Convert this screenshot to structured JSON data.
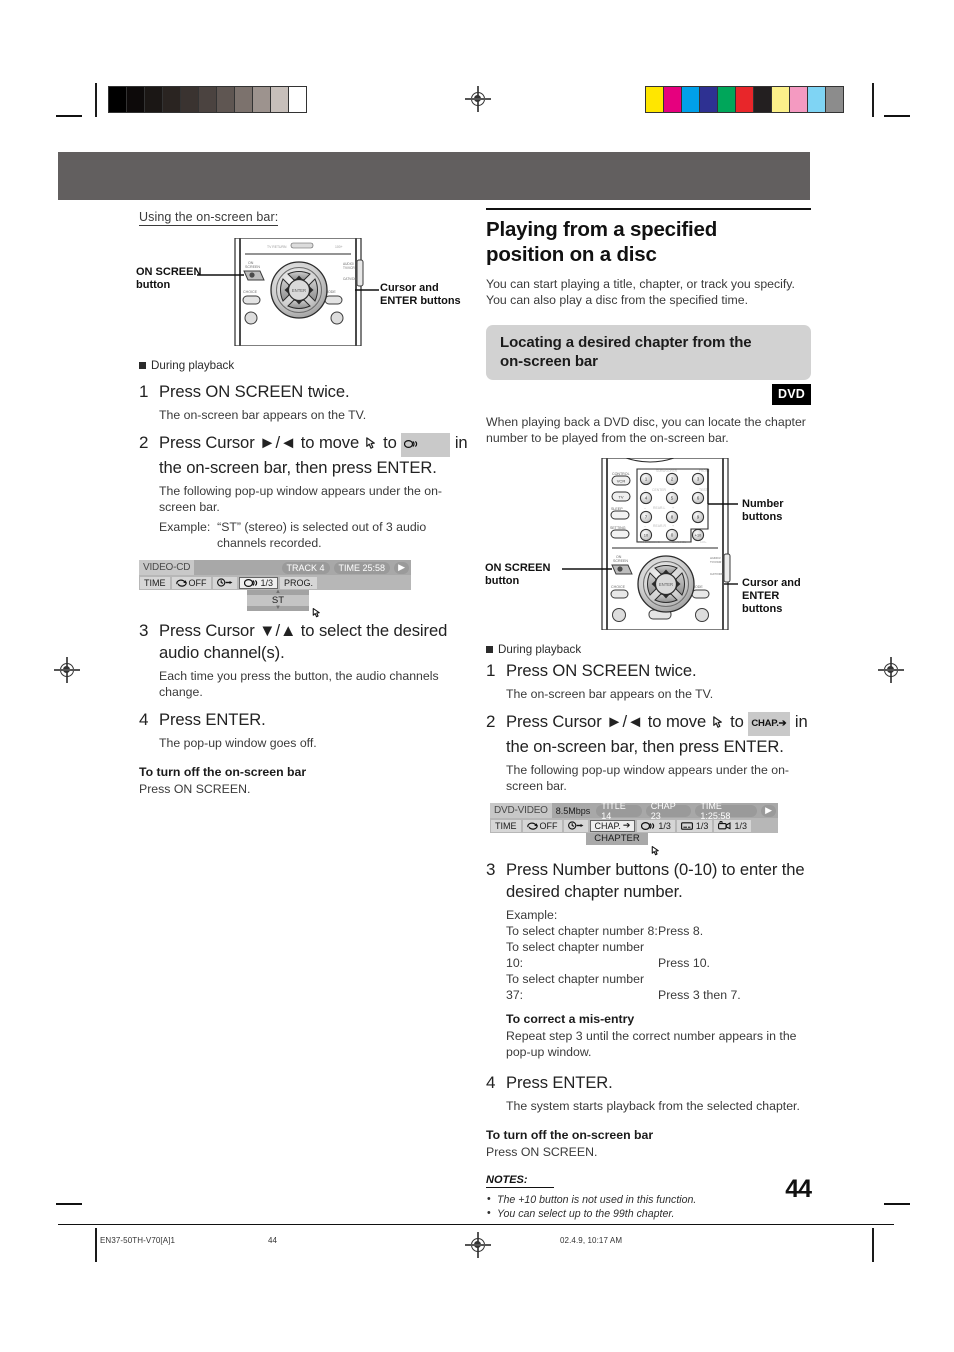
{
  "colors": {
    "masthead": "#625f5f",
    "gray_heading_box": "#d2d2d2",
    "badge_bg": "#000000",
    "osd_bar": "#b7b7b7"
  },
  "calibration": {
    "gray_wedge": [
      "#000000",
      "#0d0a0a",
      "#1b1715",
      "#2a2421",
      "#3a3330",
      "#4b4340",
      "#5f5652",
      "#7c726d",
      "#9d938e",
      "#c7bfba",
      "#ffffff"
    ],
    "color_bars": [
      "#ffe600",
      "#e6007e",
      "#00a0e9",
      "#2e3192",
      "#00a65a",
      "#e8262a",
      "#231f20",
      "#fbf08a",
      "#f49ac1",
      "#7fd4f4",
      "#8c8c8c"
    ]
  },
  "left_column": {
    "subhead": "Using the on-screen bar:",
    "remote": {
      "callout_on_screen": "ON SCREEN\nbutton",
      "callout_on_screen_line1": "ON SCREEN",
      "callout_on_screen_line2": "button",
      "callout_cursor_line1": "Cursor and",
      "callout_cursor_line2": "ENTER buttons",
      "button_labels": [
        "ON SCREEN",
        "CHOICE",
        "ENTER",
        "MODE",
        "AUDIO TV/VCR",
        "CATV/DBS"
      ]
    },
    "section_marker": "During playback",
    "steps": [
      {
        "num": "1",
        "title": "Press ON SCREEN twice.",
        "desc": "The on-screen bar appears on the TV."
      },
      {
        "num": "2",
        "title_pre": "Press Cursor ►/◄ to move ",
        "title_mid": " to ",
        "chip": "⟨⟨⟩",
        "title_post": " in the on-screen bar, then press ENTER.",
        "desc": "The following pop-up window appears under the on-screen bar.",
        "example_label": "Example:",
        "example_text": "“ST” (stereo) is selected out of 3 audio channels recorded."
      },
      {
        "num": "3",
        "title": "Press Cursor ▼/▲ to select the desired audio channel(s).",
        "desc": "Each time you press the button, the audio channels change."
      },
      {
        "num": "4",
        "title": "Press ENTER.",
        "desc": "The pop-up window goes off."
      }
    ],
    "turn_off_heading": "To turn off the on-screen bar",
    "turn_off_text": "Press ON SCREEN."
  },
  "left_osd": {
    "disc_label": "VIDEO-CD",
    "row1_pills": [
      "TRACK 4",
      "TIME    25:58"
    ],
    "row1_play_icon": "▶",
    "row2": [
      {
        "text": "TIME",
        "type": "box"
      },
      {
        "text": "OFF",
        "type": "box",
        "icon": "repeat"
      },
      {
        "text": "",
        "type": "box",
        "icon": "clock-arrow"
      },
      {
        "text": "1/3",
        "type": "box",
        "icon": "audio",
        "selected": true
      },
      {
        "text": "PROG.",
        "type": "box"
      }
    ],
    "popup_value": "ST"
  },
  "right_column": {
    "title_line1": "Playing from a specified",
    "title_line2": "position on a disc",
    "lede_line1": "You can start playing a title, chapter, or track you specify.",
    "lede_line2": "You can also play a disc from the specified time.",
    "gray_heading_line1": "Locating a desired chapter from the",
    "gray_heading_line2": "on-screen bar",
    "badge": "DVD",
    "intro_line1": "When playing back a DVD disc, you can locate the chapter",
    "intro_line2": "number to be played from the on-screen bar.",
    "remote": {
      "callout_number_buttons": "Number buttons",
      "callout_on_screen_line1": "ON SCREEN",
      "callout_on_screen_line2": "button",
      "callout_cursor_line1": "Cursor and",
      "callout_cursor_line2": "ENTER buttons",
      "control_label": "CONTROL",
      "side_buttons": [
        "VCR",
        "TV",
        "SLEEP",
        "SETTING",
        "CHOICE",
        "MODE"
      ],
      "faint_labels": [
        "CENTER",
        "REAR-L",
        "REAR-R",
        "TEST"
      ],
      "keypad": [
        "1",
        "2",
        "3",
        "4",
        "5",
        "6",
        "7",
        "8",
        "9",
        "10",
        "0",
        "+10"
      ],
      "enter_label": "ENTER",
      "right_labels": [
        "AUDIO TV/VCR",
        "CATV/DBS"
      ]
    },
    "section_marker": "During playback",
    "steps": [
      {
        "num": "1",
        "title": "Press ON SCREEN twice.",
        "desc": "The on-screen bar appears on the TV."
      },
      {
        "num": "2",
        "title_pre": "Press Cursor ►/◄ to move ",
        "title_mid": " to ",
        "chip": "CHAP.",
        "title_post": " in the on-screen bar, then press ENTER.",
        "desc": "The following pop-up window appears under the on-screen bar."
      },
      {
        "num": "3",
        "title": "Press Number buttons (0-10) to enter the desired chapter number.",
        "example_label": "Example:",
        "examples": [
          {
            "left": "To select chapter number 8:",
            "right": "Press 8."
          },
          {
            "left": "To select chapter number 10:",
            "right": "Press 10."
          },
          {
            "left": "To select chapter number 37:",
            "right": "Press 3 then 7."
          }
        ],
        "correct_heading": "To correct a mis-entry",
        "correct_text": "Repeat step 3 until the correct number appears in the pop-up window."
      },
      {
        "num": "4",
        "title": "Press ENTER.",
        "desc": "The system starts playback from the selected chapter."
      }
    ],
    "turn_off_heading": "To turn off the on-screen bar",
    "turn_off_text": "Press ON SCREEN.",
    "notes_heading": "NOTES:",
    "notes": [
      "The +10 button is not used in this function.",
      "You can select up to the 99th chapter."
    ]
  },
  "right_osd": {
    "disc_label": "DVD-VIDEO",
    "bitrate": "8.5Mbps",
    "row1_pills": [
      "TITLE 14",
      "CHAP 23",
      "TIME 1:25:58"
    ],
    "row1_play_icon": "▶",
    "row2": [
      {
        "text": "TIME"
      },
      {
        "text": "OFF"
      },
      {
        "text": ""
      },
      {
        "text": "CHAP.",
        "selected": true
      },
      {
        "text": "1/3"
      },
      {
        "text": "1/3"
      },
      {
        "text": "1/3"
      }
    ],
    "popup_value": "CHAPTER"
  },
  "footer": {
    "page_number": "44",
    "file_id": "EN37-50TH-V70[A]1",
    "folio_small": "44",
    "timestamp": "02.4.9, 10:17 AM"
  }
}
